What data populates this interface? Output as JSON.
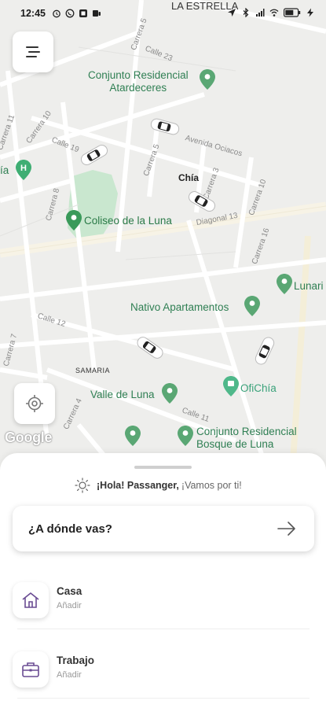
{
  "status_bar": {
    "time": "12:45",
    "carrier": "LA ESTRELLA"
  },
  "map": {
    "streets": [
      "Carrera 5",
      "Calle 23",
      "Carrera 11",
      "Carrera 10",
      "Calle 19",
      "Avenida Ociacos",
      "Carrera 5",
      "Carrera 3",
      "Carrera 8",
      "Carrera 10",
      "Diagonal 13",
      "Carrera 16",
      "Calle 12",
      "Carrera 7",
      "Carrera 4",
      "Calle 11"
    ],
    "places": {
      "conjunto_atardeceres": "Conjunto Residencial\nAtardeceres",
      "coliseo": "Coliseo de la Luna",
      "nativo": "Nativo Apartamentos",
      "valle": "Valle de Luna",
      "oficia": "OfiChía",
      "lunaria": "Lunari",
      "bosque": "Conjunto Residencial\nBosque de Luna",
      "hospital_fragment": "ía"
    },
    "city": "Chía",
    "area": "SAMARIA",
    "attribution": "Google"
  },
  "sheet": {
    "greeting_bold": "¡Hola! Passanger,",
    "greeting_rest": "¡Vamos por ti!",
    "search_label": "¿A dónde vas?",
    "favorites": [
      {
        "title": "Casa",
        "subtitle": "Añadir",
        "icon": "home-icon"
      },
      {
        "title": "Trabajo",
        "subtitle": "Añadir",
        "icon": "briefcase-icon"
      }
    ]
  },
  "colors": {
    "accent": "#6a4c93",
    "place_green": "#2f7f53",
    "map_bg": "#eeeeec"
  }
}
